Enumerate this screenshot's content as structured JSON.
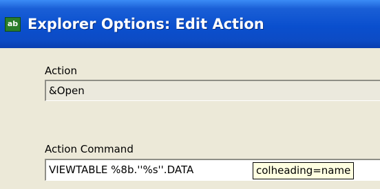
{
  "window": {
    "icon_text": "ab",
    "title": "Explorer Options: Edit Action"
  },
  "form": {
    "action_label": "Action",
    "action_value": "&Open",
    "command_label": "Action Command",
    "command_value": "VIEWTABLE %8b.''%s''.DATA"
  },
  "tooltip": {
    "text": "colheading=name"
  },
  "colors": {
    "titlebar": "#0a4fce",
    "dialog_bg": "#ece9d8",
    "tooltip_bg": "#ffffe1"
  }
}
